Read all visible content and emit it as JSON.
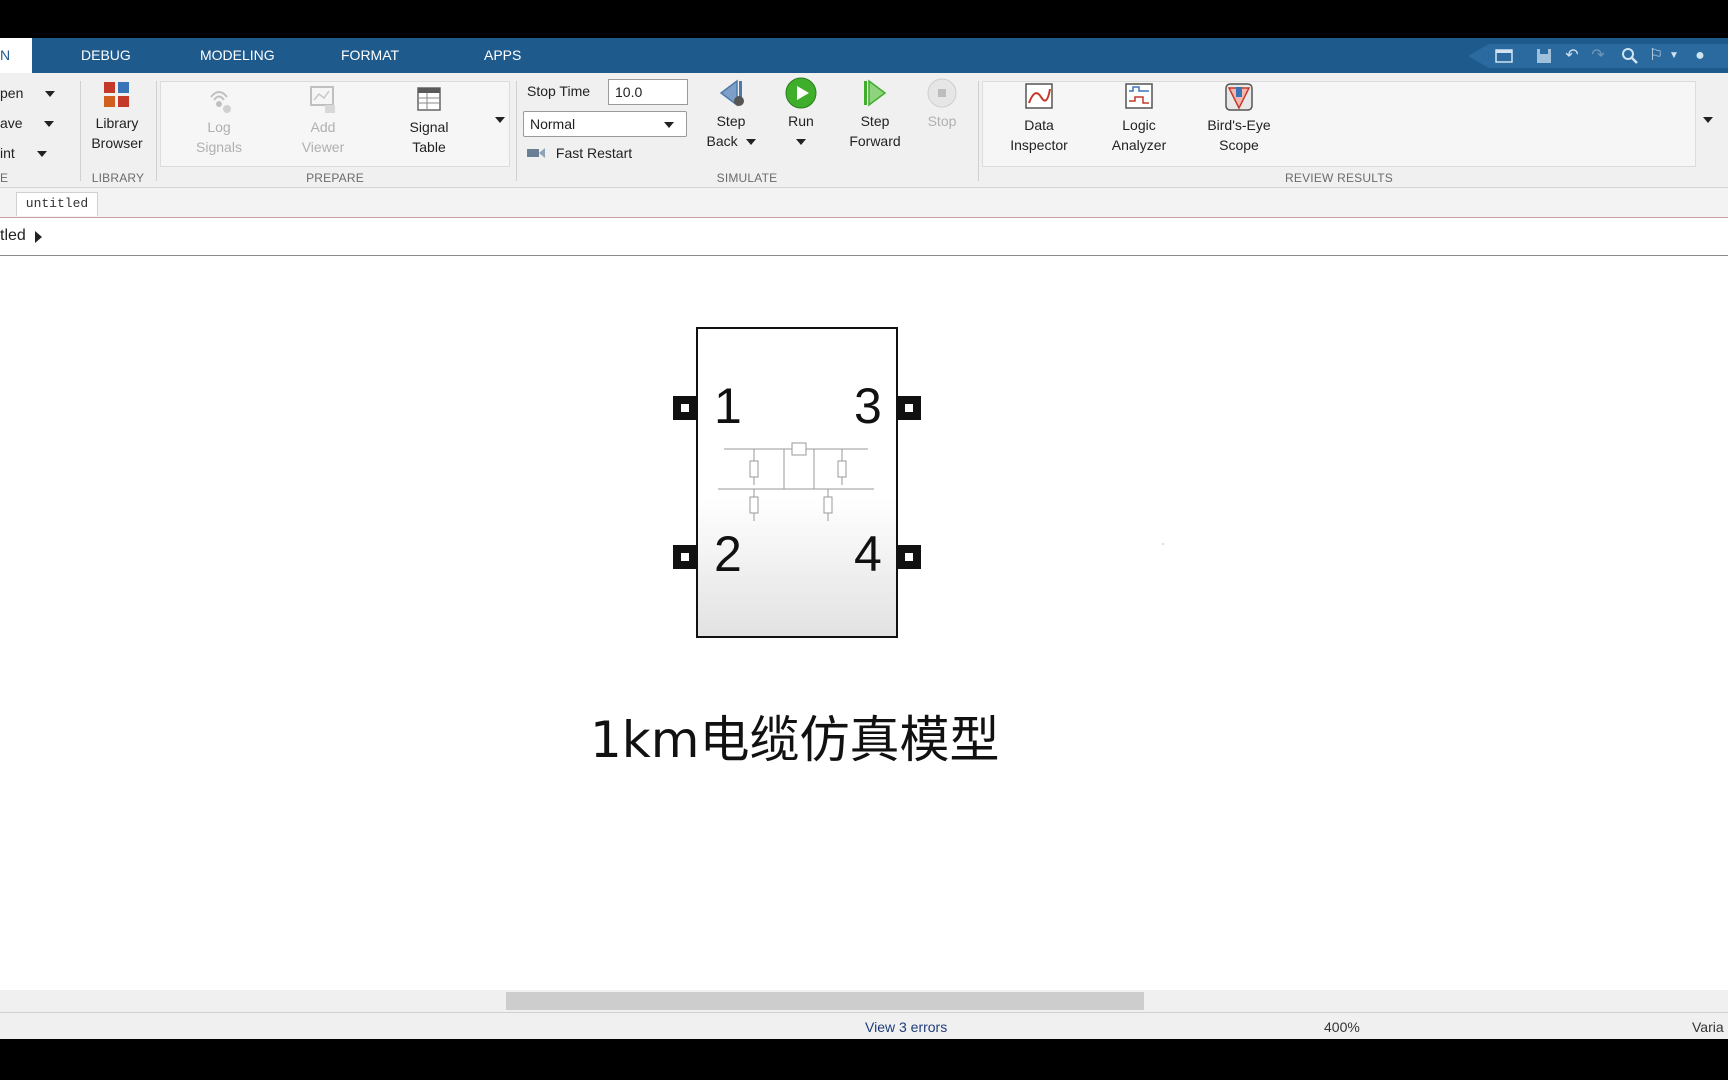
{
  "tabs": [
    {
      "label": "N",
      "active": true
    },
    {
      "label": "DEBUG"
    },
    {
      "label": "MODELING"
    },
    {
      "label": "FORMAT"
    },
    {
      "label": "APPS"
    }
  ],
  "file_group": {
    "items": [
      "pen",
      "ave",
      "int"
    ],
    "title": "E"
  },
  "library_group": {
    "button": [
      "Library",
      "Browser"
    ],
    "title": "LIBRARY"
  },
  "prepare_group": {
    "log": [
      "Log",
      "Signals"
    ],
    "viewer": [
      "Add",
      "Viewer"
    ],
    "table": [
      "Signal",
      "Table"
    ],
    "title": "PREPARE"
  },
  "simulate_group": {
    "stop_time_label": "Stop Time",
    "stop_time_value": "10.0",
    "mode": "Normal",
    "fast_restart": "Fast Restart",
    "step_back": [
      "Step",
      "Back"
    ],
    "run": "Run",
    "step_forward": [
      "Step",
      "Forward"
    ],
    "stop": "Stop",
    "title": "SIMULATE"
  },
  "review_group": {
    "data": [
      "Data",
      "Inspector"
    ],
    "logic": [
      "Logic",
      "Analyzer"
    ],
    "birdseye": [
      "Bird's-Eye",
      "Scope"
    ],
    "title": "REVIEW RESULTS"
  },
  "doc_tab": "untitled",
  "breadcrumb": "tled",
  "block": {
    "ports": [
      "1",
      "2",
      "3",
      "4"
    ],
    "label": "1km电缆仿真模型"
  },
  "status": {
    "errors": "View 3 errors",
    "zoom": "400%",
    "solver": "Varia"
  },
  "colors": {
    "tabstrip": "#1f5a8c",
    "run_green": "#3fae2a",
    "status_link": "#1f3d7a"
  }
}
